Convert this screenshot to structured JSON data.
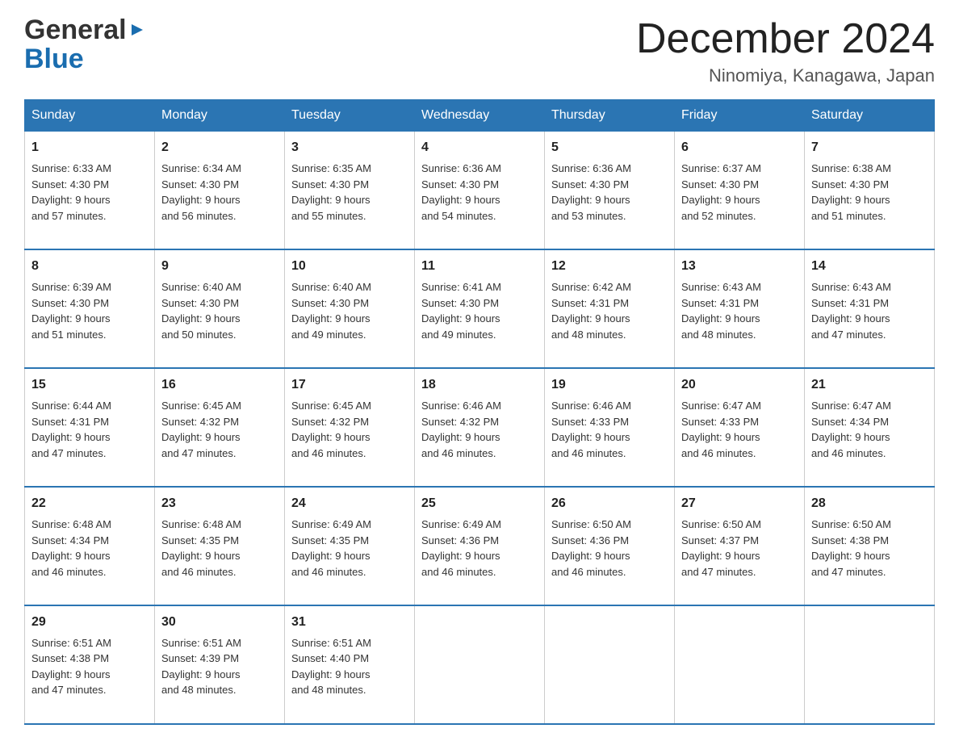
{
  "header": {
    "logo_general": "General",
    "logo_blue": "Blue",
    "month_title": "December 2024",
    "location": "Ninomiya, Kanagawa, Japan"
  },
  "weekdays": [
    "Sunday",
    "Monday",
    "Tuesday",
    "Wednesday",
    "Thursday",
    "Friday",
    "Saturday"
  ],
  "weeks": [
    [
      {
        "day": "1",
        "sunrise": "6:33 AM",
        "sunset": "4:30 PM",
        "daylight": "9 hours and 57 minutes."
      },
      {
        "day": "2",
        "sunrise": "6:34 AM",
        "sunset": "4:30 PM",
        "daylight": "9 hours and 56 minutes."
      },
      {
        "day": "3",
        "sunrise": "6:35 AM",
        "sunset": "4:30 PM",
        "daylight": "9 hours and 55 minutes."
      },
      {
        "day": "4",
        "sunrise": "6:36 AM",
        "sunset": "4:30 PM",
        "daylight": "9 hours and 54 minutes."
      },
      {
        "day": "5",
        "sunrise": "6:36 AM",
        "sunset": "4:30 PM",
        "daylight": "9 hours and 53 minutes."
      },
      {
        "day": "6",
        "sunrise": "6:37 AM",
        "sunset": "4:30 PM",
        "daylight": "9 hours and 52 minutes."
      },
      {
        "day": "7",
        "sunrise": "6:38 AM",
        "sunset": "4:30 PM",
        "daylight": "9 hours and 51 minutes."
      }
    ],
    [
      {
        "day": "8",
        "sunrise": "6:39 AM",
        "sunset": "4:30 PM",
        "daylight": "9 hours and 51 minutes."
      },
      {
        "day": "9",
        "sunrise": "6:40 AM",
        "sunset": "4:30 PM",
        "daylight": "9 hours and 50 minutes."
      },
      {
        "day": "10",
        "sunrise": "6:40 AM",
        "sunset": "4:30 PM",
        "daylight": "9 hours and 49 minutes."
      },
      {
        "day": "11",
        "sunrise": "6:41 AM",
        "sunset": "4:30 PM",
        "daylight": "9 hours and 49 minutes."
      },
      {
        "day": "12",
        "sunrise": "6:42 AM",
        "sunset": "4:31 PM",
        "daylight": "9 hours and 48 minutes."
      },
      {
        "day": "13",
        "sunrise": "6:43 AM",
        "sunset": "4:31 PM",
        "daylight": "9 hours and 48 minutes."
      },
      {
        "day": "14",
        "sunrise": "6:43 AM",
        "sunset": "4:31 PM",
        "daylight": "9 hours and 47 minutes."
      }
    ],
    [
      {
        "day": "15",
        "sunrise": "6:44 AM",
        "sunset": "4:31 PM",
        "daylight": "9 hours and 47 minutes."
      },
      {
        "day": "16",
        "sunrise": "6:45 AM",
        "sunset": "4:32 PM",
        "daylight": "9 hours and 47 minutes."
      },
      {
        "day": "17",
        "sunrise": "6:45 AM",
        "sunset": "4:32 PM",
        "daylight": "9 hours and 46 minutes."
      },
      {
        "day": "18",
        "sunrise": "6:46 AM",
        "sunset": "4:32 PM",
        "daylight": "9 hours and 46 minutes."
      },
      {
        "day": "19",
        "sunrise": "6:46 AM",
        "sunset": "4:33 PM",
        "daylight": "9 hours and 46 minutes."
      },
      {
        "day": "20",
        "sunrise": "6:47 AM",
        "sunset": "4:33 PM",
        "daylight": "9 hours and 46 minutes."
      },
      {
        "day": "21",
        "sunrise": "6:47 AM",
        "sunset": "4:34 PM",
        "daylight": "9 hours and 46 minutes."
      }
    ],
    [
      {
        "day": "22",
        "sunrise": "6:48 AM",
        "sunset": "4:34 PM",
        "daylight": "9 hours and 46 minutes."
      },
      {
        "day": "23",
        "sunrise": "6:48 AM",
        "sunset": "4:35 PM",
        "daylight": "9 hours and 46 minutes."
      },
      {
        "day": "24",
        "sunrise": "6:49 AM",
        "sunset": "4:35 PM",
        "daylight": "9 hours and 46 minutes."
      },
      {
        "day": "25",
        "sunrise": "6:49 AM",
        "sunset": "4:36 PM",
        "daylight": "9 hours and 46 minutes."
      },
      {
        "day": "26",
        "sunrise": "6:50 AM",
        "sunset": "4:36 PM",
        "daylight": "9 hours and 46 minutes."
      },
      {
        "day": "27",
        "sunrise": "6:50 AM",
        "sunset": "4:37 PM",
        "daylight": "9 hours and 47 minutes."
      },
      {
        "day": "28",
        "sunrise": "6:50 AM",
        "sunset": "4:38 PM",
        "daylight": "9 hours and 47 minutes."
      }
    ],
    [
      {
        "day": "29",
        "sunrise": "6:51 AM",
        "sunset": "4:38 PM",
        "daylight": "9 hours and 47 minutes."
      },
      {
        "day": "30",
        "sunrise": "6:51 AM",
        "sunset": "4:39 PM",
        "daylight": "9 hours and 48 minutes."
      },
      {
        "day": "31",
        "sunrise": "6:51 AM",
        "sunset": "4:40 PM",
        "daylight": "9 hours and 48 minutes."
      },
      null,
      null,
      null,
      null
    ]
  ],
  "labels": {
    "sunrise": "Sunrise:",
    "sunset": "Sunset:",
    "daylight": "Daylight:"
  }
}
